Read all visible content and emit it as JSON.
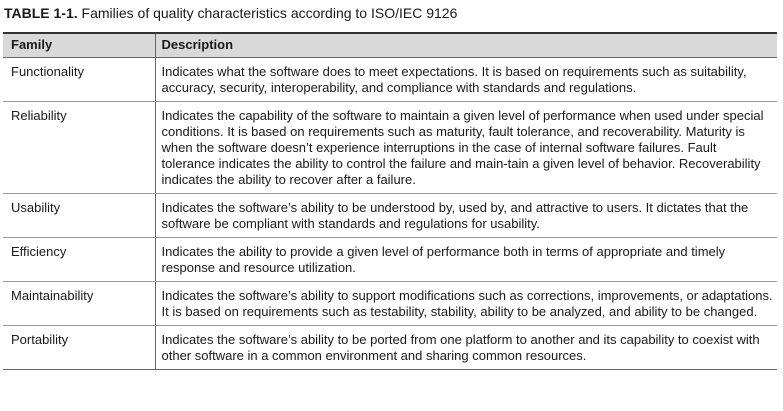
{
  "caption": {
    "label": "TABLE 1-1.",
    "text": " Families of quality characteristics according to ISO/IEC 9126"
  },
  "table": {
    "headers": {
      "family": "Family",
      "description": "Description"
    },
    "rows": [
      {
        "family": "Functionality",
        "description": "Indicates what the software does to meet expectations. It is based on requirements such as suitability, accuracy, security, interoperability, and compliance with standards and regulations."
      },
      {
        "family": "Reliability",
        "description": "Indicates the capability of the software to maintain a given level of performance when used under special conditions. It is based on requirements such as maturity, fault tolerance, and recoverability. Maturity is when the software doesn’t experience interruptions in the case of internal software failures. Fault tolerance indicates the ability to control the failure and main-tain a given level of behavior. Recoverability indicates the ability to recover after a failure."
      },
      {
        "family": "Usability",
        "description": "Indicates the software’s ability to be understood by, used by, and attractive to users. It dictates that the software be compliant with standards and regulations for usability."
      },
      {
        "family": "Efficiency",
        "description": "Indicates the ability to provide a given level of performance both in terms of appropriate and timely response and resource utilization."
      },
      {
        "family": "Maintainability",
        "description": "Indicates the software’s ability to support modifications such as corrections, improvements, or adaptations. It is based on requirements such as testability, stability, ability to be analyzed, and ability to be changed."
      },
      {
        "family": "Portability",
        "description": "Indicates the software’s ability to be ported from one platform to another and its capability to coexist with other software in a common environment and sharing common resources."
      }
    ]
  }
}
